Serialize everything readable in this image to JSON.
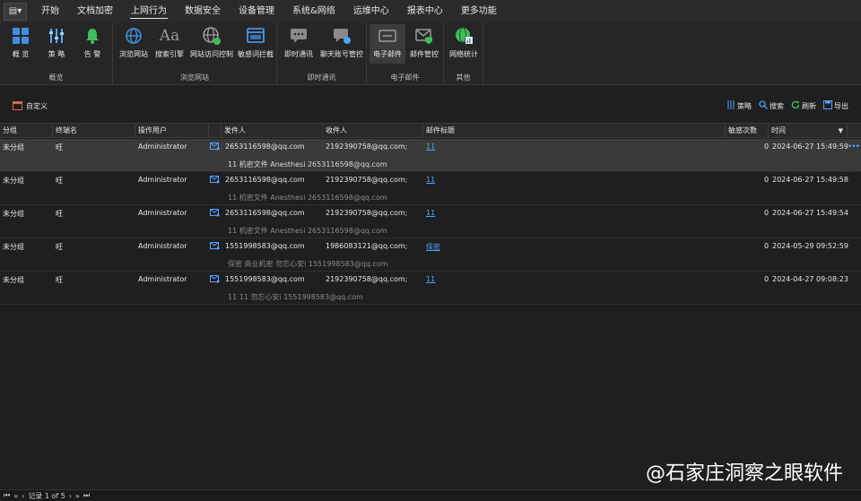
{
  "menubar": {
    "app_icon": "app-menu-icon",
    "items": [
      "开始",
      "文档加密",
      "上网行为",
      "数据安全",
      "设备管理",
      "系统&网络",
      "运维中心",
      "报表中心",
      "更多功能"
    ],
    "active_index": 2
  },
  "ribbon": {
    "groups": [
      {
        "label": "概览",
        "buttons": [
          "概 览",
          "策 略",
          "告 警"
        ]
      },
      {
        "label": "浏览网站",
        "buttons": [
          "浏览网站",
          "搜索引擎",
          "网站访问控制",
          "敏感词拦截"
        ]
      },
      {
        "label": "即时通讯",
        "buttons": [
          "即时通讯",
          "聊天账号管控"
        ]
      },
      {
        "label": "电子邮件",
        "buttons": [
          "电子邮件",
          "邮件管控"
        ]
      },
      {
        "label": "其他",
        "buttons": [
          "网络统计"
        ]
      }
    ]
  },
  "toolbar": {
    "custom": "自定义",
    "strategy": "策略",
    "search": "搜索",
    "refresh": "刷新",
    "export": "导出"
  },
  "grid": {
    "columns": [
      "分组",
      "终端名",
      "操作用户",
      "发件人",
      "收件人",
      "邮件标题",
      "敏感次数",
      "时间"
    ],
    "rows": [
      {
        "group": "未分组",
        "terminal": "旺",
        "user": "Administrator",
        "sender": "2653116598@qq.com",
        "recipient": "2192390758@qq.com;",
        "subject": "11",
        "count": "0",
        "time": "2024-06-27 15:49:59",
        "detail": "11  机密文件  Anesthesi 2653116598@qq.com",
        "selected": true
      },
      {
        "group": "未分组",
        "terminal": "旺",
        "user": "Administrator",
        "sender": "2653116598@qq.com",
        "recipient": "2192390758@qq.com;",
        "subject": "11",
        "count": "0",
        "time": "2024-06-27 15:49:58",
        "detail": "11  机密文件  Anesthesi 2653116598@qq.com",
        "selected": false
      },
      {
        "group": "未分组",
        "terminal": "旺",
        "user": "Administrator",
        "sender": "2653116598@qq.com",
        "recipient": "2192390758@qq.com;",
        "subject": "11",
        "count": "0",
        "time": "2024-06-27 15:49:54",
        "detail": "11  机密文件  Anesthesi 2653116598@qq.com",
        "selected": false
      },
      {
        "group": "未分组",
        "terminal": "旺",
        "user": "Administrator",
        "sender": "1551998583@qq.com",
        "recipient": "1986083121@qq.com;",
        "subject": "保密",
        "count": "0",
        "time": "2024-05-29 09:52:59",
        "detail": "保密  商业机密      勿忘心安i 1551998583@qq.com",
        "selected": false
      },
      {
        "group": "未分组",
        "terminal": "旺",
        "user": "Administrator",
        "sender": "1551998583@qq.com",
        "recipient": "2192390758@qq.com;",
        "subject": "11",
        "count": "0",
        "time": "2024-04-27 09:08:23",
        "detail": "11   11       勿忘心安i 1551998583@qq.com",
        "selected": false
      }
    ]
  },
  "statusbar": {
    "record": "记录 1 of 5"
  },
  "watermark": "@石家庄洞察之眼软件",
  "colors": {
    "accent": "#4da3ff",
    "bg": "#1f1f1f"
  }
}
